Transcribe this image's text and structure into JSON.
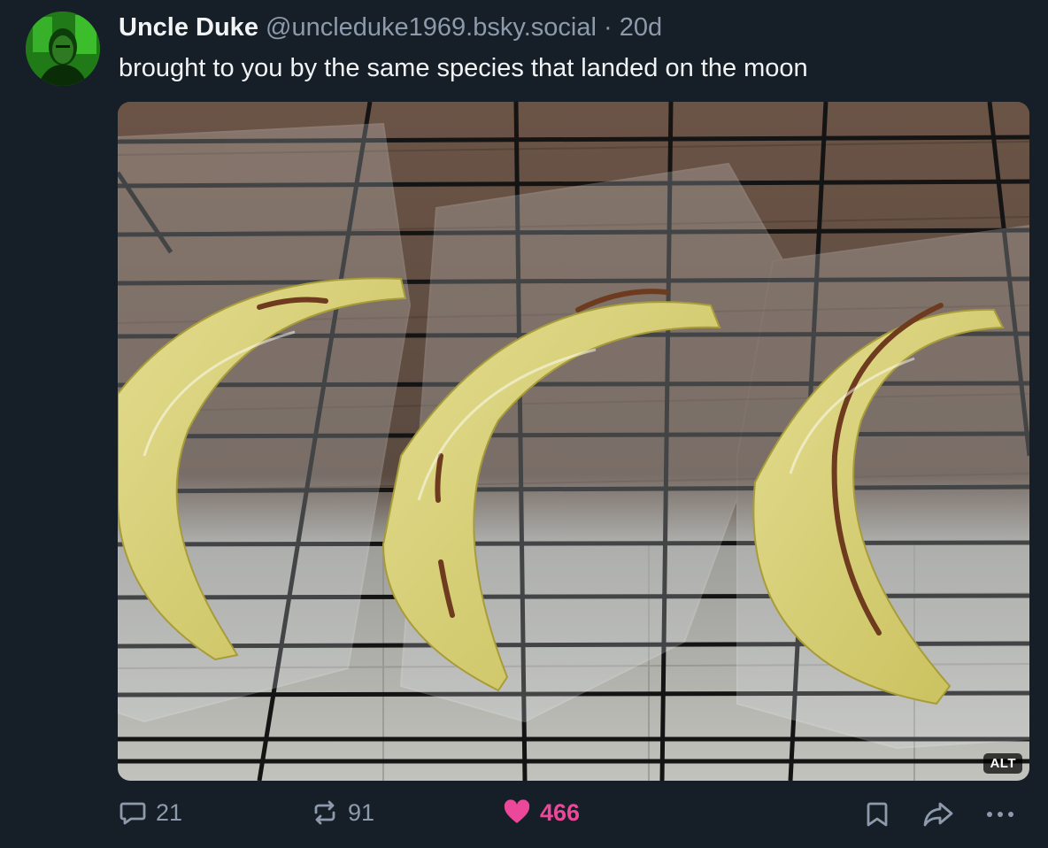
{
  "post": {
    "author_name": "Uncle Duke",
    "author_handle": "@uncleduke1969.bsky.social",
    "separator": "·",
    "timestamp": "20d",
    "text": "brought to you by the same species that landed on the moon"
  },
  "media": {
    "alt_label": "ALT"
  },
  "actions": {
    "reply_count": "21",
    "repost_count": "91",
    "like_count": "466"
  },
  "colors": {
    "background": "#161e27",
    "text": "#f1f3f5",
    "muted": "#8c9aab",
    "like": "#ec4899"
  },
  "icons": [
    "avatar",
    "reply-icon",
    "repost-icon",
    "heart-icon",
    "bookmark-icon",
    "share-icon",
    "more-icon"
  ]
}
